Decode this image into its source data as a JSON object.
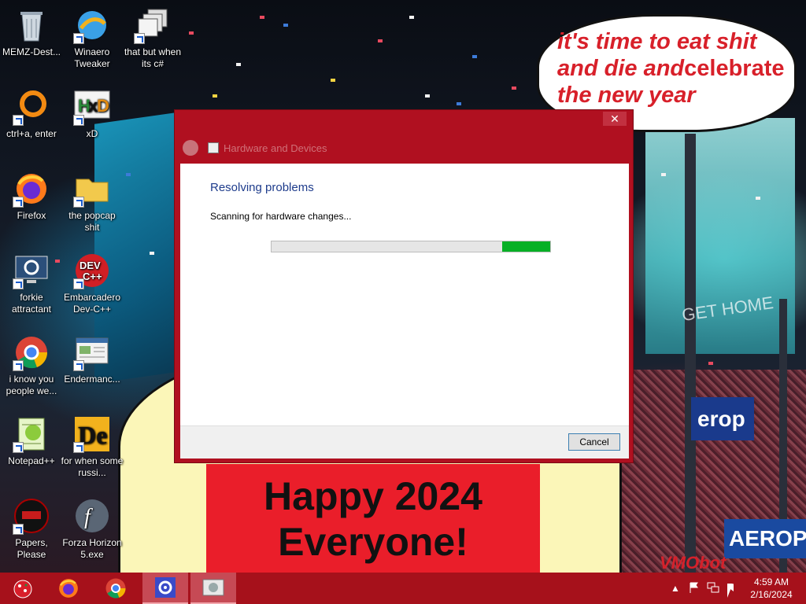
{
  "desktop": {
    "icons": [
      {
        "label": "MEMZ-Dest...",
        "icon": "recycle-bin-icon"
      },
      {
        "label": "Winaero Tweaker",
        "icon": "winaero-icon"
      },
      {
        "label": "that but when its c#",
        "icon": "windows-stack-icon"
      },
      {
        "label": "ctrl+a, enter",
        "icon": "orange-ring-icon"
      },
      {
        "label": "xD",
        "icon": "hxd-icon"
      },
      {
        "label": "Firefox",
        "icon": "firefox-icon"
      },
      {
        "label": "the popcap shit",
        "icon": "folder-icon"
      },
      {
        "label": "forkie attractant",
        "icon": "settings-monitor-icon"
      },
      {
        "label": "Embarcadero Dev-C++",
        "icon": "devcpp-icon"
      },
      {
        "label": "i know you people we...",
        "icon": "chrome-icon"
      },
      {
        "label": "Endermanc...",
        "icon": "window-app-icon"
      },
      {
        "label": "Notepad++",
        "icon": "notepadpp-icon"
      },
      {
        "label": "for when some russi...",
        "icon": "de-icon"
      },
      {
        "label": "Papers, Please",
        "icon": "papers-please-icon"
      },
      {
        "label": "Forza Horizon 5.exe",
        "icon": "flash-icon"
      }
    ]
  },
  "wallpaper": {
    "speech_line1": "it's time to eat shit",
    "speech_line2a": "and die and",
    "speech_line2b": "celebrate",
    "speech_line3": "the new year",
    "banner_line1": "Happy 2024",
    "banner_line2": "Everyone!",
    "sign_blue": "erop",
    "sign_aero": "AEROPOS",
    "sign_green": "GET HOME",
    "signature": "VMObot"
  },
  "dialog": {
    "title": "Hardware and Devices",
    "heading": "Resolving problems",
    "status": "Scanning for hardware changes...",
    "progress_label": "Indeterminate progress",
    "cancel_label": "Cancel",
    "close_glyph": "✕"
  },
  "taskbar": {
    "time": "4:59 AM",
    "date": "2/16/2024",
    "tray_chevron": "▲",
    "accent": "#a6111b"
  }
}
